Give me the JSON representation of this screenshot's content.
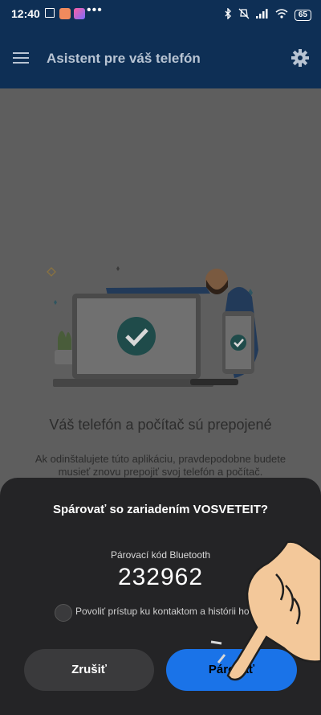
{
  "status": {
    "time": "12:40",
    "battery": "65"
  },
  "appbar": {
    "title": "Asistent pre váš telefón"
  },
  "main": {
    "connected_title": "Váš telefón a počítač sú prepojené",
    "connected_desc": "Ak odinštalujete túto aplikáciu, pravdepodobne budete musieť znovu prepojiť svoj telefón a počítač."
  },
  "dialog": {
    "title": "Spárovať so zariadením VOSVETEIT?",
    "code_label": "Párovací kód Bluetooth",
    "code": "232962",
    "checkbox_label": "Povoliť prístup ku kontaktom a histórii hov",
    "checkbox_checked": false,
    "cancel_label": "Zrušiť",
    "pair_label": "Párovať"
  },
  "colors": {
    "appbar": "#0e2f55",
    "accent": "#1a73e8",
    "sheet": "#242426"
  }
}
